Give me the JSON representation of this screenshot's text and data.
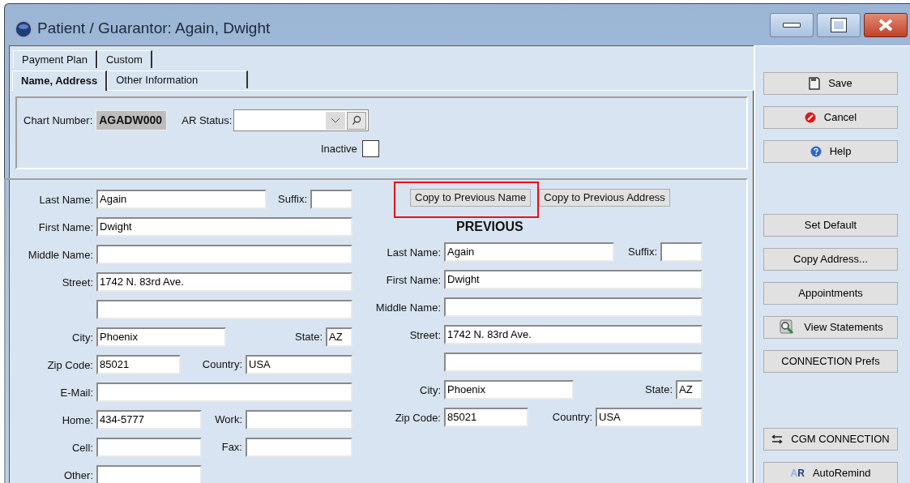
{
  "window": {
    "title": "Patient / Guarantor: Again, Dwight"
  },
  "tab_rows": [
    {
      "tabs": [
        {
          "label": "Payment Plan",
          "selected": false
        },
        {
          "label": "Custom",
          "selected": false
        }
      ]
    },
    {
      "tabs": [
        {
          "label": "Name, Address",
          "selected": true
        },
        {
          "label": "Other Information",
          "selected": false
        }
      ]
    }
  ],
  "header": {
    "chart_number": {
      "label": "Chart Number:",
      "value": "AGADW000"
    },
    "ar_status": {
      "label": "AR Status:"
    },
    "inactive": {
      "label": "Inactive",
      "checked": false
    }
  },
  "name_form": {
    "rows": [
      {
        "fields": [
          {
            "label": "Last Name:",
            "value": "Again"
          },
          {
            "label": "Suffix:"
          }
        ]
      },
      {
        "fields": [
          {
            "label": "First Name:",
            "value": "Dwight"
          }
        ]
      },
      {
        "fields": [
          {
            "label": "Middle Name:"
          }
        ]
      },
      {
        "fields": [
          {
            "label": "Street:",
            "value": "1742 N. 83rd Ave."
          }
        ]
      },
      {
        "kind": "blank"
      },
      {
        "fields": [
          {
            "label": "City:",
            "value": "Phoenix"
          },
          {
            "label": "State:",
            "value": "AZ"
          }
        ]
      },
      {
        "fields": [
          {
            "label": "Zip Code:",
            "value": "85021"
          },
          {
            "label": "Country:",
            "value": "USA"
          }
        ]
      },
      {
        "fields": [
          {
            "label": "E-Mail:"
          }
        ]
      },
      {
        "fields": [
          {
            "label": "Home:",
            "value": "434-5777"
          },
          {
            "label": "Work:"
          }
        ]
      },
      {
        "fields": [
          {
            "label": "Cell:"
          },
          {
            "label": "Fax:"
          }
        ]
      },
      {
        "fields": [
          {
            "label": "Other:"
          }
        ]
      }
    ]
  },
  "copy_buttons": [
    {
      "label": "Copy to Previous Name",
      "highlighted": true
    },
    {
      "label": "Copy to Previous Address",
      "highlighted": false
    }
  ],
  "previous_form": {
    "heading": "PREVIOUS",
    "rows": [
      {
        "fields": [
          {
            "label": "Last Name:",
            "value": "Again"
          },
          {
            "label": "Suffix:"
          }
        ]
      },
      {
        "fields": [
          {
            "label": "First Name:",
            "value": "Dwight"
          }
        ]
      },
      {
        "fields": [
          {
            "label": "Middle Name:"
          }
        ]
      },
      {
        "fields": [
          {
            "label": "Street:",
            "value": "1742 N. 83rd Ave."
          }
        ]
      },
      {
        "kind": "blank"
      },
      {
        "fields": [
          {
            "label": "City:",
            "value": "Phoenix"
          },
          {
            "label": "State:",
            "value": "AZ"
          }
        ]
      },
      {
        "fields": [
          {
            "label": "Zip Code:",
            "value": "85021"
          },
          {
            "label": "Country:",
            "value": "USA"
          }
        ]
      }
    ]
  },
  "side_button_groups": [
    {
      "buttons": [
        {
          "label": "Save"
        },
        {
          "label": "Cancel"
        },
        {
          "label": "Help"
        }
      ]
    },
    {
      "buttons": [
        {
          "label": "Set Default"
        },
        {
          "label": "Copy Address..."
        },
        {
          "label": "Appointments"
        },
        {
          "label": "View Statements"
        },
        {
          "label": "CONNECTION Prefs"
        }
      ]
    },
    {
      "buttons": [
        {
          "label": "CGM CONNECTION"
        },
        {
          "label": "AutoRemind",
          "badge": "AR"
        }
      ]
    }
  ]
}
